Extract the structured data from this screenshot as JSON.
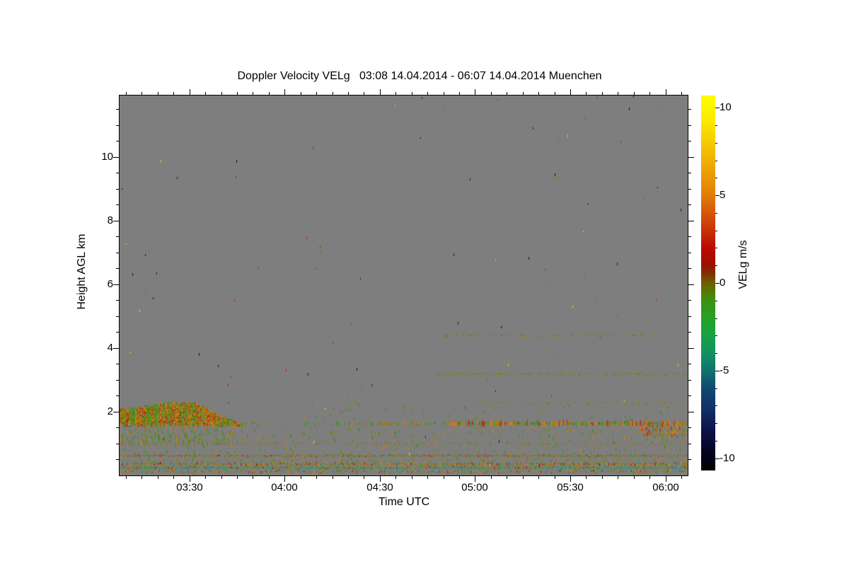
{
  "chart_data": {
    "type": "heatmap",
    "title": "Doppler Velocity VELg   03:08 14.04.2014 - 06:07 14.04.2014 Muenchen",
    "xlabel": "Time UTC",
    "ylabel": "Height AGL km",
    "background_color": "#7e7e7e",
    "frame_color": "#000000",
    "x_axis": {
      "start_min": 188,
      "end_min": 367,
      "start_label": "03:08",
      "end_label": "06:07",
      "major_ticks": [
        {
          "t": 210,
          "label": "03:30"
        },
        {
          "t": 240,
          "label": "04:00"
        },
        {
          "t": 270,
          "label": "04:30"
        },
        {
          "t": 300,
          "label": "05:00"
        },
        {
          "t": 330,
          "label": "05:30"
        },
        {
          "t": 360,
          "label": "06:00"
        }
      ],
      "minor_step_min": 5
    },
    "y_axis": {
      "min_km": 0,
      "max_km": 11.93,
      "major_ticks": [
        {
          "km": 2,
          "label": "2"
        },
        {
          "km": 4,
          "label": "4"
        },
        {
          "km": 6,
          "label": "6"
        },
        {
          "km": 8,
          "label": "8"
        },
        {
          "km": 10,
          "label": "10"
        }
      ],
      "minor_step_km": 0.5
    },
    "colorbar": {
      "label": "VELg m/s",
      "value_range": [
        -10.7,
        10.7
      ],
      "major_ticks": [
        {
          "v": 10,
          "label": "10"
        },
        {
          "v": 5,
          "label": "5"
        },
        {
          "v": 0,
          "label": "0"
        },
        {
          "v": -5,
          "label": "-5"
        },
        {
          "v": -10,
          "label": "-10"
        }
      ],
      "minor_step": 1,
      "gradient_stops": [
        [
          -10.7,
          "#000000"
        ],
        [
          -9.8,
          "#04041c"
        ],
        [
          -8.5,
          "#0a1148"
        ],
        [
          -7.2,
          "#133066"
        ],
        [
          -6.0,
          "#0e4a70"
        ],
        [
          -5.0,
          "#127270"
        ],
        [
          -4.0,
          "#129260"
        ],
        [
          -3.0,
          "#17a244"
        ],
        [
          -2.0,
          "#27a026"
        ],
        [
          -1.0,
          "#3f9012"
        ],
        [
          -0.4,
          "#587500"
        ],
        [
          0.0,
          "#6e5e00"
        ],
        [
          0.5,
          "#7c3400"
        ],
        [
          1.0,
          "#9a1000"
        ],
        [
          2.0,
          "#ba0a00"
        ],
        [
          3.0,
          "#c93206"
        ],
        [
          4.0,
          "#d55708"
        ],
        [
          5.0,
          "#e17d06"
        ],
        [
          6.5,
          "#eda304"
        ],
        [
          8.0,
          "#f6c902"
        ],
        [
          9.3,
          "#fcea00"
        ],
        [
          10.7,
          "#fffb00"
        ]
      ]
    },
    "palettes": {
      "noise": [
        [
          "#d57a10",
          0.18
        ],
        [
          "#bb2210",
          0.16
        ],
        [
          "#e8d80a",
          0.14
        ],
        [
          "#3f8f1c",
          0.16
        ],
        [
          "#1d9a86",
          0.1
        ],
        [
          "#101010",
          0.12
        ],
        [
          "#14124a",
          0.06
        ],
        [
          "#8a7a10",
          0.08
        ]
      ],
      "oliveLine": [
        [
          "#8a7a10",
          0.72
        ],
        [
          "#6f8a12",
          0.15
        ],
        [
          "#bb3a10",
          0.06
        ],
        [
          "#3f8f1c",
          0.07
        ]
      ],
      "oliveRed": [
        [
          "#8a7a10",
          0.6
        ],
        [
          "#bb2210",
          0.2
        ],
        [
          "#3f8f1c",
          0.2
        ]
      ],
      "greenOlive": [
        [
          "#3f8f1c",
          0.5
        ],
        [
          "#8a7a10",
          0.33
        ],
        [
          "#d57a10",
          0.17
        ]
      ],
      "bandMix": [
        [
          "#8a7a10",
          0.3
        ],
        [
          "#d57a10",
          0.25
        ],
        [
          "#bb2210",
          0.15
        ],
        [
          "#3f8f1c",
          0.2
        ],
        [
          "#1d9a86",
          0.1
        ]
      ],
      "tealBand": [
        [
          "#1d9a86",
          0.4
        ],
        [
          "#2f9a2f",
          0.28
        ],
        [
          "#bb2210",
          0.14
        ],
        [
          "#8a7a10",
          0.13
        ],
        [
          "#d57a10",
          0.05
        ]
      ],
      "band16": [
        [
          "#d57a10",
          0.33
        ],
        [
          "#bb2210",
          0.17
        ],
        [
          "#8a7a10",
          0.2
        ],
        [
          "#3f8f1c",
          0.2
        ],
        [
          "#2f9a2f",
          0.1
        ]
      ],
      "orangeHeavy": [
        [
          "#d57a10",
          0.45
        ],
        [
          "#bb2210",
          0.2
        ],
        [
          "#8a7a10",
          0.2
        ],
        [
          "#3f8f1c",
          0.15
        ]
      ],
      "blobWarm": [
        [
          "#d57a10",
          0.45
        ],
        [
          "#bb2210",
          0.25
        ],
        [
          "#8a7a10",
          0.3
        ]
      ],
      "blobCool": [
        [
          "#3f8f1c",
          0.55
        ],
        [
          "#8a7a10",
          0.3
        ],
        [
          "#2f9a2f",
          0.15
        ]
      ]
    },
    "features": {
      "noise": {
        "count": 150,
        "palette": "noise"
      },
      "blob": {
        "t_start": 188,
        "t_end": 227,
        "base_km": 1.58,
        "density": 0.88,
        "top_profile": [
          [
            0,
            2.08
          ],
          [
            6,
            2.16
          ],
          [
            10,
            2.2
          ],
          [
            14,
            2.28
          ],
          [
            18,
            2.3
          ],
          [
            22,
            2.3
          ],
          [
            26,
            2.18
          ],
          [
            29,
            2.0
          ],
          [
            32,
            1.86
          ],
          [
            35,
            1.74
          ],
          [
            39,
            1.64
          ]
        ]
      },
      "bands": [
        {
          "km": 4.4,
          "t": [
            290,
            356
          ],
          "h": 3,
          "d": 0.3,
          "p": "oliveLine"
        },
        {
          "km": 3.18,
          "t": [
            288,
            367
          ],
          "h": 3,
          "d": 0.45,
          "p": "oliveLine"
        },
        {
          "km": 2.27,
          "t": [
            301,
            367
          ],
          "h": 3,
          "d": 0.22,
          "p": "oliveLine"
        },
        {
          "km": 1.62,
          "t": [
            222,
            232
          ],
          "h": 3,
          "d": 0.5,
          "p": "greenOlive"
        },
        {
          "km": 1.62,
          "t": [
            232,
            256
          ],
          "h": 4,
          "d": 0.15,
          "p": "greenOlive"
        },
        {
          "km": 1.62,
          "t": [
            256,
            291
          ],
          "h": 6,
          "d": 0.4,
          "p": "greenOlive"
        },
        {
          "km": 1.63,
          "t": [
            291,
            367
          ],
          "h": 9,
          "d": 0.85,
          "p": "band16"
        },
        {
          "km": 1.26,
          "t": [
            355,
            366
          ],
          "h": 2,
          "d": 0.97,
          "p": "oliveLine"
        },
        {
          "km": 1.0,
          "t": [
            188,
            367
          ],
          "h": 2,
          "d": 0.4,
          "p": "oliveLine"
        },
        {
          "km": 0.62,
          "t": [
            188,
            367
          ],
          "h": 2,
          "d": 0.95,
          "p": "oliveRed"
        },
        {
          "km": 0.46,
          "t": [
            188,
            367
          ],
          "h": 2,
          "d": 0.25,
          "p": "greenOlive"
        },
        {
          "km": 0.36,
          "t": [
            188,
            367
          ],
          "h": 4,
          "d": 0.92,
          "p": "bandMix"
        },
        {
          "km": 0.24,
          "t": [
            188,
            367
          ],
          "h": 3,
          "d": 0.9,
          "p": "tealBand"
        },
        {
          "km": 0.12,
          "t": [
            188,
            367
          ],
          "h": 3,
          "d": 0.55,
          "p": "bandMix"
        }
      ],
      "clouds": [
        {
          "t": [
            188,
            224
          ],
          "km": [
            1.0,
            1.5
          ],
          "count": 200,
          "p": "greenOlive",
          "size": [
            2,
            6
          ]
        },
        {
          "t": [
            188,
            367
          ],
          "km": [
            0.55,
            1.5
          ],
          "count": 380,
          "p": "greenOlive",
          "size": [
            2,
            5
          ]
        },
        {
          "t": [
            246,
            367
          ],
          "km": [
            1.25,
            2.35
          ],
          "count": 130,
          "p": "greenOlive",
          "size": [
            2,
            5
          ]
        },
        {
          "t": [
            352,
            367
          ],
          "km": [
            1.3,
            1.62
          ],
          "count": 90,
          "p": "orangeHeavy",
          "size": [
            2,
            6
          ]
        },
        {
          "t": [
            188,
            367
          ],
          "km": [
            0.05,
            0.5
          ],
          "count": 120,
          "p": "bandMix",
          "size": [
            2,
            4
          ]
        }
      ]
    }
  }
}
